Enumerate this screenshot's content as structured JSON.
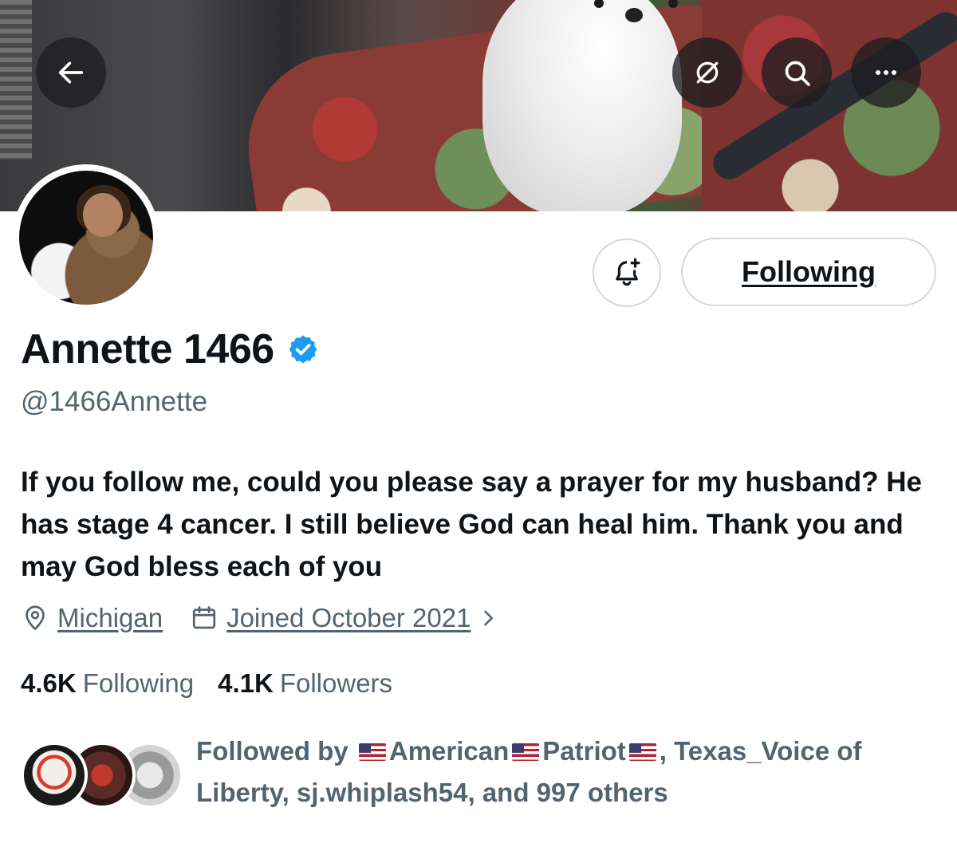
{
  "header": {
    "back_icon": "arrow-left-icon",
    "grok_icon": "grok-icon",
    "search_icon": "search-icon",
    "more_icon": "more-icon"
  },
  "profile": {
    "display_name": "Annette 1466",
    "verified": true,
    "handle": "@1466Annette",
    "bio": "If you follow me, could you please say a prayer for my husband? He has stage 4 cancer. I still believe God can heal him. Thank you and may God bless each of you",
    "location": "Michigan",
    "joined": "Joined October 2021"
  },
  "actions": {
    "notify_icon": "bell-plus-icon",
    "following_label": "Following"
  },
  "stats": {
    "following_count": "4.6K",
    "following_label": "Following",
    "followers_count": "4.1K",
    "followers_label": "Followers"
  },
  "followed_by": {
    "prefix": "Followed by",
    "name1": "American",
    "name1b": "Patriot",
    "rest_line1": ", Texas_Voice of",
    "rest_line2": "Liberty, sj.whiplash54, and 997 others"
  },
  "colors": {
    "verified_blue": "#1d9bf0",
    "secondary_text": "#536471",
    "primary_text": "#0f1419"
  }
}
